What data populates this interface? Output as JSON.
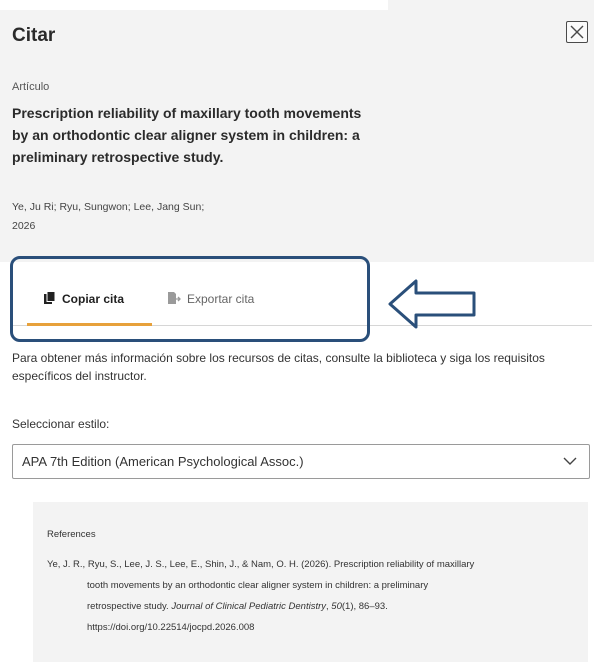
{
  "dialog": {
    "title": "Citar",
    "close_icon": "close-icon"
  },
  "article": {
    "type": "Artículo",
    "title": "Prescription reliability of maxillary tooth movements by an orthodontic clear aligner system in children: a preliminary retrospective study.",
    "authors": "Ye, Ju Ri; Ryu, Sungwon; Lee, Jang Sun;",
    "year": "2026"
  },
  "tabs": [
    {
      "label": "Copiar cita",
      "icon": "clipboard-icon",
      "active": true
    },
    {
      "label": "Exportar cita",
      "icon": "export-document-icon",
      "active": false
    }
  ],
  "info_text": "Para obtener más información sobre los recursos de citas, consulte la biblioteca y siga los requisitos específicos del instructor.",
  "style_select": {
    "label": "Seleccionar estilo:",
    "value": "APA 7th Edition (American Psychological Assoc.)",
    "chevron_icon": "chevron-down-icon"
  },
  "reference": {
    "heading": "References",
    "line1": "Ye, J. R., Ryu, S., Lee, J. S., Lee, E., Shin, J., & Nam, O. H. (2026). Prescription reliability of maxillary",
    "line2": "tooth movements by an orthodontic clear aligner system in children: a preliminary",
    "line3_plain": "retrospective study. ",
    "line3_journal": "Journal of Clinical Pediatric Dentistry",
    "line3_sep": ", ",
    "line3_volume": "50",
    "line3_rest": "(1), 86–93.",
    "line4": "https://doi.org/10.22514/jocpd.2026.008"
  },
  "colors": {
    "accent_tab": "#e7a13b",
    "annotation": "#2a4f7a",
    "header_bg": "#f3f3f3"
  }
}
